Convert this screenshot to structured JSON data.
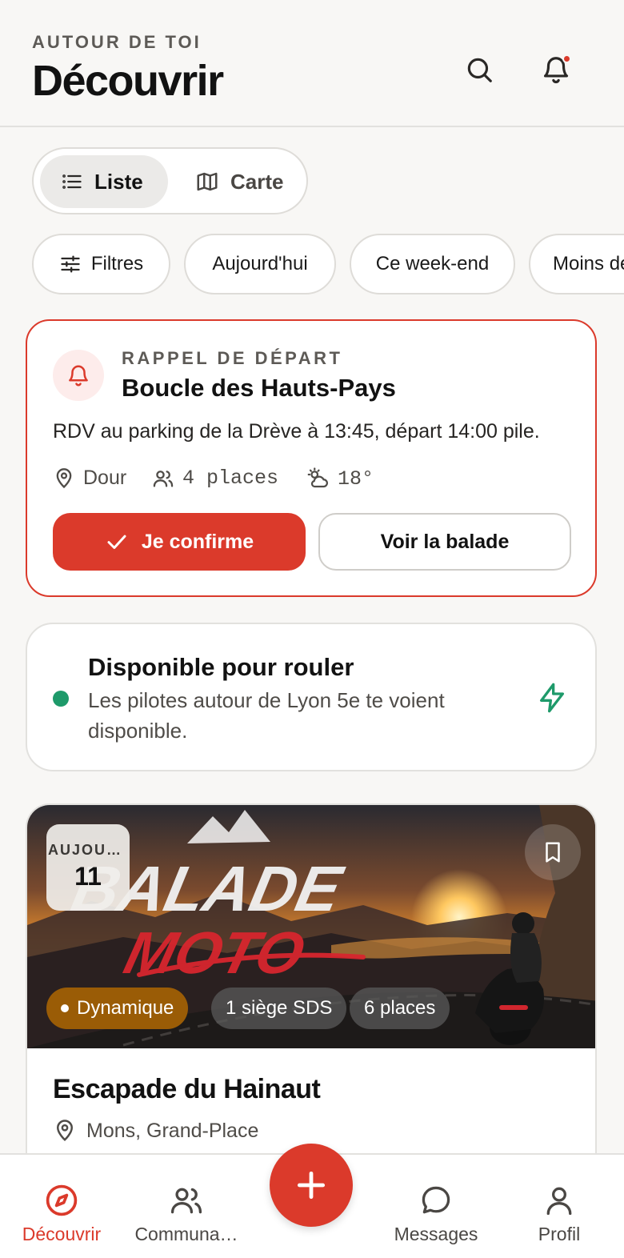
{
  "header": {
    "eyebrow": "AUTOUR DE TOI",
    "title": "Découvrir",
    "icons": [
      "search-icon",
      "bell-icon"
    ]
  },
  "view_toggle": {
    "options": [
      {
        "label": "Liste",
        "icon": "list-icon",
        "selected": true
      },
      {
        "label": "Carte",
        "icon": "map-icon",
        "selected": false
      }
    ]
  },
  "filters": [
    {
      "label": "Filtres",
      "icon": "sliders-icon"
    },
    {
      "label": "Aujourd'hui"
    },
    {
      "label": "Ce week-end"
    },
    {
      "label": "Moins de"
    }
  ],
  "reminder": {
    "eyebrow": "RAPPEL DE DÉPART",
    "title": "Boucle des Hauts-Pays",
    "text": "RDV au parking de la Drève à 13:45, départ 14:00 pile.",
    "location": "Dour",
    "places": "4 places",
    "weather": "18°",
    "confirm_label": "Je confirme",
    "view_label": "Voir la balade",
    "accent": "#db3a2b"
  },
  "availability": {
    "title": "Disponible pour rouler",
    "subtitle": "Les pilotes autour de Lyon 5e te voient disponible.",
    "status_color": "#1e9a6a"
  },
  "event": {
    "date_month": "AUJOURD'HUI",
    "date_day": "11",
    "cover_title_line1": "BALADE",
    "cover_title_line2": "MOTO",
    "tags": [
      "Dynamique",
      "1 siège SDS",
      "6 places"
    ],
    "title": "Escapade du Hainaut",
    "location": "Mons, Grand-Place"
  },
  "tabbar": {
    "tabs": [
      {
        "label": "Découvrir",
        "icon": "compass-icon",
        "active": true
      },
      {
        "label": "Communa…",
        "icon": "users-icon",
        "active": false
      },
      {
        "label": "Messages",
        "icon": "chat-bubble-icon",
        "active": false
      },
      {
        "label": "Profil",
        "icon": "user-icon",
        "active": false
      }
    ],
    "fab_icon": "plus-icon"
  }
}
